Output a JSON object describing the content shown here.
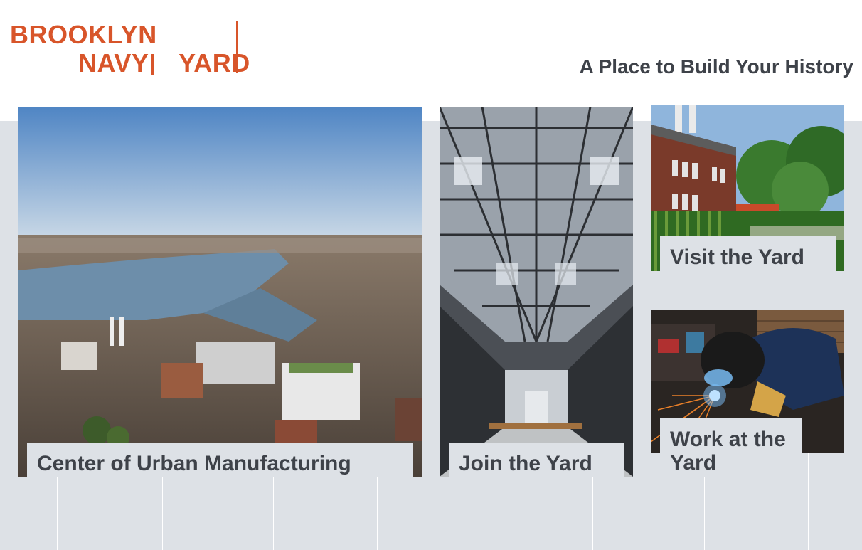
{
  "brand": {
    "line1": "BROOKLYN",
    "line2a": "NAVY",
    "line2b": "YARD",
    "color": "#d8552a"
  },
  "tagline": "A Place to Build Your History",
  "tiles": [
    {
      "caption": "Center of Urban Manufacturing",
      "image": "aerial-city-photo"
    },
    {
      "caption": "Join the Yard",
      "image": "industrial-hall-photo"
    },
    {
      "caption": "Visit the Yard",
      "image": "brick-building-garden-photo"
    },
    {
      "caption": "Work at the Yard",
      "image": "welder-photo"
    }
  ],
  "colors": {
    "band": "#dde1e6",
    "caption_text": "#3e4249"
  }
}
